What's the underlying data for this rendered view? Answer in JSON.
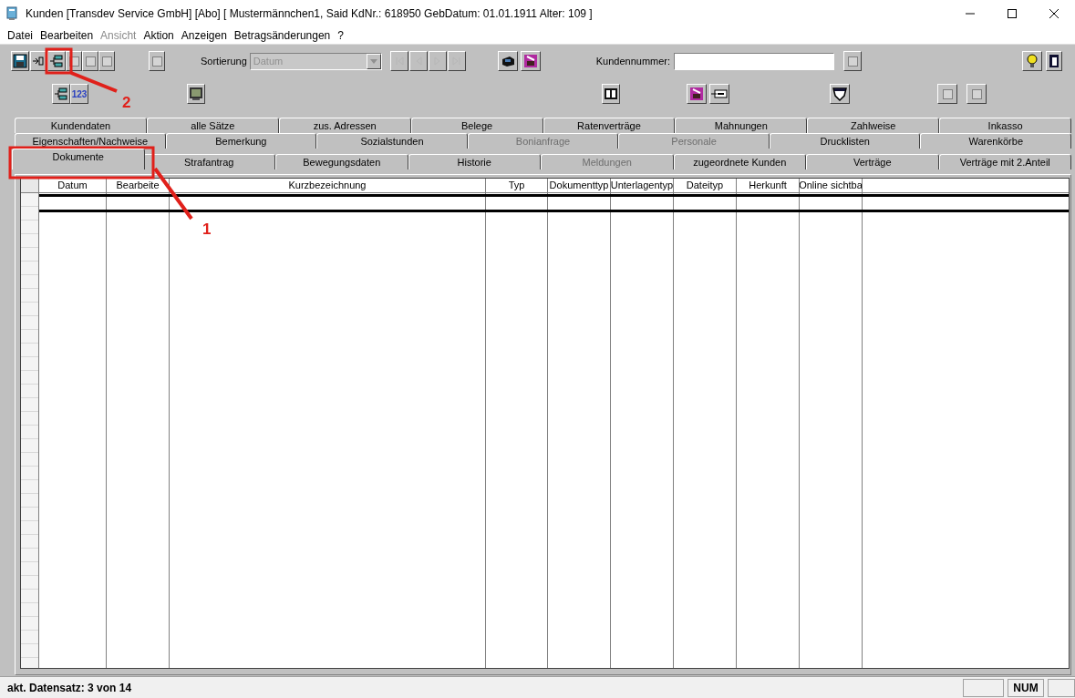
{
  "window": {
    "title": "Kunden [Transdev Service GmbH] [Abo] [ Mustermännchen1, Said KdNr.: 618950 GebDatum: 01.01.1911 Alter: 109 ]"
  },
  "menu": [
    {
      "label": "Datei",
      "disabled": false
    },
    {
      "label": "Bearbeiten",
      "disabled": false
    },
    {
      "label": "Ansicht",
      "disabled": true
    },
    {
      "label": "Aktion",
      "disabled": false
    },
    {
      "label": "Anzeigen",
      "disabled": false
    },
    {
      "label": "Betragsänderungen",
      "disabled": false
    },
    {
      "label": "?",
      "disabled": false
    }
  ],
  "toolbar": {
    "row_1": [
      {
        "kind": "save",
        "disabled": false
      },
      {
        "kind": "back",
        "disabled": false
      },
      {
        "kind": "tree",
        "disabled": false
      },
      {
        "kind": "blank",
        "disabled": true
      },
      {
        "kind": "blank",
        "disabled": true
      },
      {
        "kind": "blank",
        "disabled": true
      },
      {
        "kind": "blank",
        "disabled": true
      },
      {
        "kind": "label",
        "text": "Sortierung"
      },
      {
        "kind": "select",
        "value": "Datum",
        "disabled": true
      },
      {
        "kind": "first",
        "disabled": true
      },
      {
        "kind": "prev",
        "disabled": true
      },
      {
        "kind": "next",
        "disabled": true
      },
      {
        "kind": "last",
        "disabled": true
      },
      {
        "kind": "tape",
        "disabled": false
      },
      {
        "kind": "stamp",
        "disabled": false
      },
      {
        "kind": "label",
        "text": "Kundennummer:"
      },
      {
        "kind": "input"
      },
      {
        "kind": "blank",
        "disabled": true
      },
      {
        "kind": "help",
        "disabled": false
      },
      {
        "kind": "exit",
        "disabled": false
      }
    ],
    "row_2": [
      {
        "kind": "tree",
        "disabled": false
      },
      {
        "kind": "numbers",
        "text": "123",
        "disabled": false
      },
      {
        "kind": "monitor",
        "disabled": false
      },
      {
        "kind": "book",
        "disabled": false
      },
      {
        "kind": "stamp",
        "disabled": false
      },
      {
        "kind": "card",
        "disabled": false
      },
      {
        "kind": "shield",
        "disabled": false
      },
      {
        "kind": "blank",
        "disabled": true
      },
      {
        "kind": "blank",
        "disabled": true
      }
    ]
  },
  "tabs": [
    [
      {
        "label": "Kundendaten",
        "selected": false,
        "disabled": false
      },
      {
        "label": "alle Sätze",
        "selected": false,
        "disabled": false
      },
      {
        "label": "zus. Adressen",
        "selected": false,
        "disabled": false
      },
      {
        "label": "Belege",
        "selected": false,
        "disabled": false
      },
      {
        "label": "Ratenverträge",
        "selected": false,
        "disabled": false
      },
      {
        "label": "Mahnungen",
        "selected": false,
        "disabled": false
      },
      {
        "label": "Zahlweise",
        "selected": false,
        "disabled": false
      },
      {
        "label": "Inkasso",
        "selected": false,
        "disabled": false
      }
    ],
    [
      {
        "label": "Eigenschaften/Nachweise",
        "selected": false,
        "disabled": false
      },
      {
        "label": "Bemerkung",
        "selected": false,
        "disabled": false
      },
      {
        "label": "Sozialstunden",
        "selected": false,
        "disabled": false
      },
      {
        "label": "Bonianfrage",
        "selected": false,
        "disabled": true
      },
      {
        "label": "Personale",
        "selected": false,
        "disabled": true
      },
      {
        "label": "Drucklisten",
        "selected": false,
        "disabled": false
      },
      {
        "label": "Warenkörbe",
        "selected": false,
        "disabled": false
      }
    ],
    [
      {
        "label": "Dokumente",
        "selected": true,
        "disabled": false
      },
      {
        "label": "Strafantrag",
        "selected": false,
        "disabled": false
      },
      {
        "label": "Bewegungsdaten",
        "selected": false,
        "disabled": false
      },
      {
        "label": "Historie",
        "selected": false,
        "disabled": false
      },
      {
        "label": "Meldungen",
        "selected": false,
        "disabled": true
      },
      {
        "label": "zugeordnete Kunden",
        "selected": false,
        "disabled": false
      },
      {
        "label": "Verträge",
        "selected": false,
        "disabled": false
      },
      {
        "label": "Verträge mit 2.Anteil",
        "selected": false,
        "disabled": false
      }
    ]
  ],
  "table": {
    "columns": [
      "Datum",
      "Bearbeite",
      "Kurzbezeichnung",
      "Typ",
      "Dokumenttyp",
      "Unterlagentyp",
      "Dateityp",
      "Herkunft",
      "Online sichtba"
    ]
  },
  "annotations": [
    {
      "label": "1"
    },
    {
      "label": "2"
    }
  ],
  "status_bar": {
    "text": "akt. Datensatz: 3 von 14",
    "panels": [
      "NUM"
    ]
  }
}
